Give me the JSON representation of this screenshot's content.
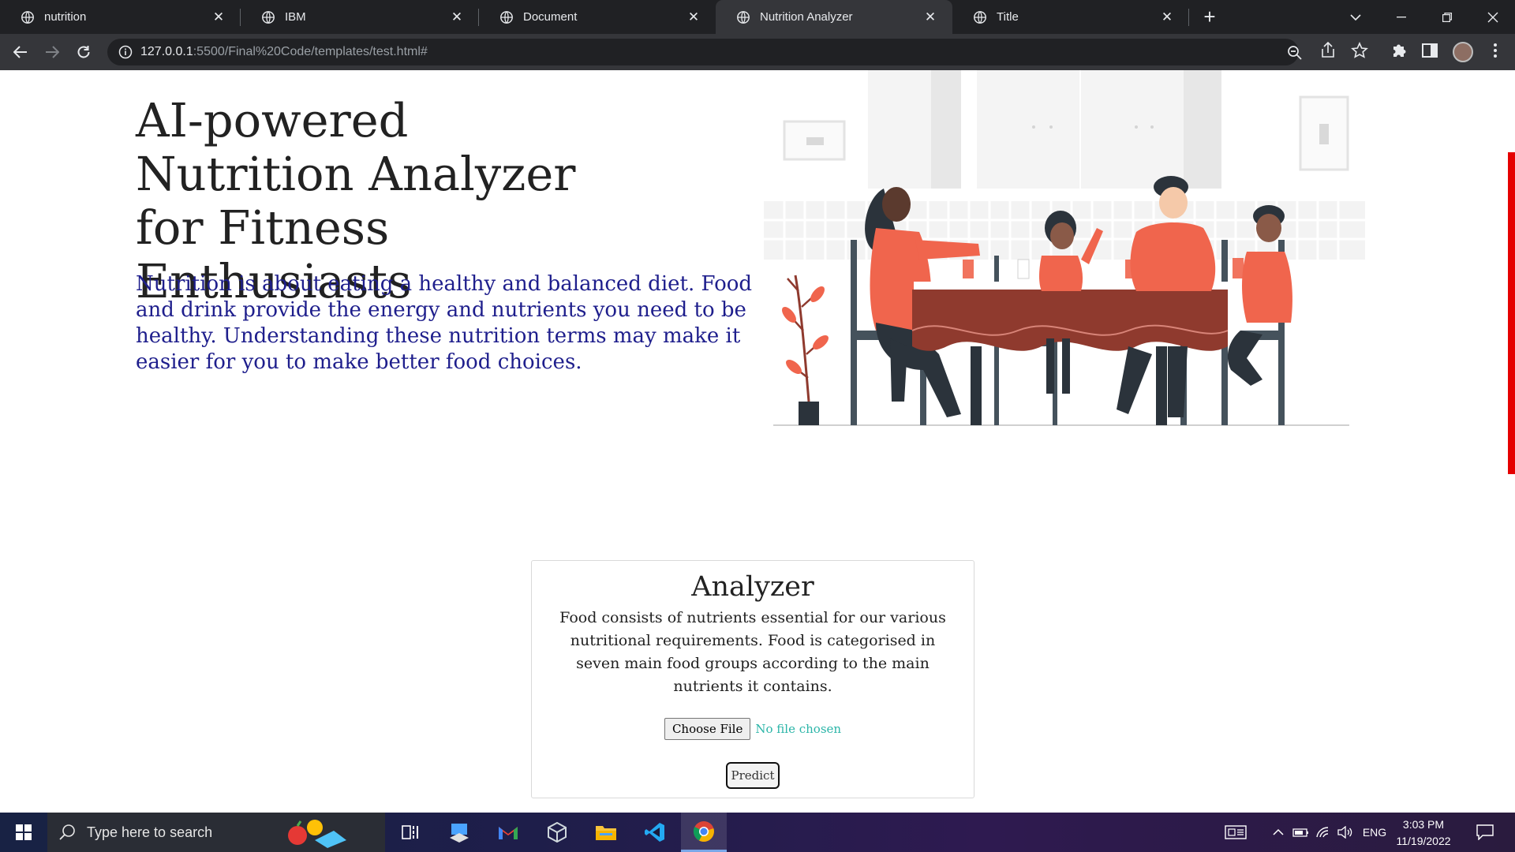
{
  "browser": {
    "tabs": [
      {
        "title": "nutrition",
        "active": false
      },
      {
        "title": "IBM",
        "active": false
      },
      {
        "title": "Document",
        "active": false
      },
      {
        "title": "Nutrition Analyzer",
        "active": true
      },
      {
        "title": "Title",
        "active": false
      }
    ],
    "address": {
      "host": "127.0.0.1",
      "path": ":5500/Final%20Code/templates/test.html#"
    }
  },
  "hero": {
    "title": "AI-powered Nutrition Analyzer for Fitness Enthusiasts",
    "description": "Nutrition is about eating a healthy and balanced diet. Food and drink provide the energy and nutrients you need to be healthy. Understanding these nutrition terms may make it easier for you to make better food choices."
  },
  "analyzer": {
    "heading": "Analyzer",
    "description": "Food consists of nutrients essential for our various nutritional requirements. Food is categorised in seven main food groups according to the main nutrients it contains.",
    "choose_file_label": "Choose File",
    "file_status": "No file chosen",
    "predict_label": "Predict"
  },
  "taskbar": {
    "search_placeholder": "Type here to search",
    "language": "ENG",
    "time": "3:03 PM",
    "date": "11/19/2022"
  },
  "colors": {
    "accent_red": "#e50000",
    "description_blue": "#1e1e8c",
    "file_status_teal": "#2bb5a8",
    "illustration_coral": "#f0654d",
    "illustration_table": "#8f3a2e",
    "illustration_dark": "#2b333b"
  }
}
